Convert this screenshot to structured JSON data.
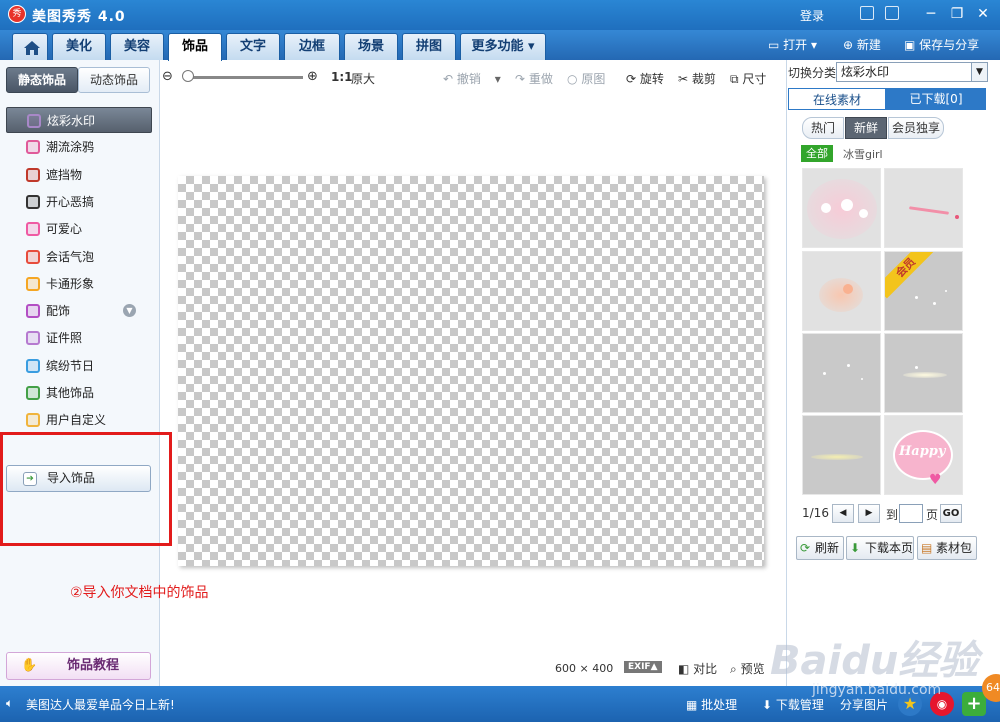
{
  "app": {
    "title": "美图秀秀 4.0",
    "logo_text": "秀"
  },
  "titlebar": {
    "login": "登录"
  },
  "nav": {
    "tabs": [
      {
        "label": "美化"
      },
      {
        "label": "美容"
      },
      {
        "label": "饰品"
      },
      {
        "label": "文字"
      },
      {
        "label": "边框"
      },
      {
        "label": "场景"
      },
      {
        "label": "拼图"
      },
      {
        "label": "更多功能 ▾"
      }
    ],
    "open": "打开",
    "new": "新建",
    "save_share": "保存与分享"
  },
  "left": {
    "tabs": [
      "静态饰品",
      "动态饰品"
    ],
    "items": [
      {
        "label": "炫彩水印",
        "icon": "sparkle-icon",
        "color": "#a888c8"
      },
      {
        "label": "潮流涂鸦",
        "icon": "lips-icon",
        "color": "#e05a9a"
      },
      {
        "label": "遮挡物",
        "icon": "mask-icon",
        "color": "#c0392b"
      },
      {
        "label": "开心恶搞",
        "icon": "prank-icon",
        "color": "#333333"
      },
      {
        "label": "可爱心",
        "icon": "heart-icon",
        "color": "#ef5aa3"
      },
      {
        "label": "会话气泡",
        "icon": "bubble-icon",
        "color": "#e74c3c"
      },
      {
        "label": "卡通形象",
        "icon": "cartoon-icon",
        "color": "#f5a623"
      },
      {
        "label": "配饰",
        "icon": "bow-icon",
        "color": "#b34fc4"
      },
      {
        "label": "证件照",
        "icon": "shirt-icon",
        "color": "#b67ad0"
      },
      {
        "label": "缤纷节日",
        "icon": "gift-icon",
        "color": "#3a9de0"
      },
      {
        "label": "其他饰品",
        "icon": "star-icon",
        "color": "#43a047"
      },
      {
        "label": "用户自定义",
        "icon": "folder-icon",
        "color": "#f0b43c"
      }
    ],
    "import": "导入饰品",
    "tutorial": "饰品教程"
  },
  "toolbar": {
    "zoom_original": "1:1",
    "original_size": "原大",
    "undo": "撤销",
    "redo": "重做",
    "restore": "原图",
    "rotate": "旋转",
    "crop": "裁剪",
    "resize": "尺寸"
  },
  "annotation": "②导入你文档中的饰品",
  "canvas_bottom": {
    "size": "600 × 400",
    "exif": "EXIF▲",
    "compare": "对比",
    "preview": "预览"
  },
  "right": {
    "switch_label": "切换分类",
    "category": "炫彩水印",
    "tabs": [
      "在线素材",
      "已下载[0]"
    ],
    "filters": [
      "热门",
      "新鲜",
      "会员独享"
    ],
    "all": "全部",
    "author": "冰雪girl",
    "thumb_badge": "会员",
    "thumb_text": "Happy",
    "pager": {
      "page": "1/16",
      "goto": "到",
      "unit": "页",
      "go": "GO"
    },
    "actions": [
      "刷新",
      "下载本页",
      "素材包"
    ]
  },
  "status": {
    "marquee": "美图达人最爱单品今日上新!",
    "batch": "批处理",
    "download_mgr": "下载管理",
    "share": "分享图片",
    "badge": "64"
  },
  "watermark": {
    "text": "Baidu经验",
    "url": "jingyan.baidu.com"
  },
  "colors": {
    "accent": "#1f6fbe",
    "highlight": "#e21b1b",
    "member": "#32a52b"
  }
}
